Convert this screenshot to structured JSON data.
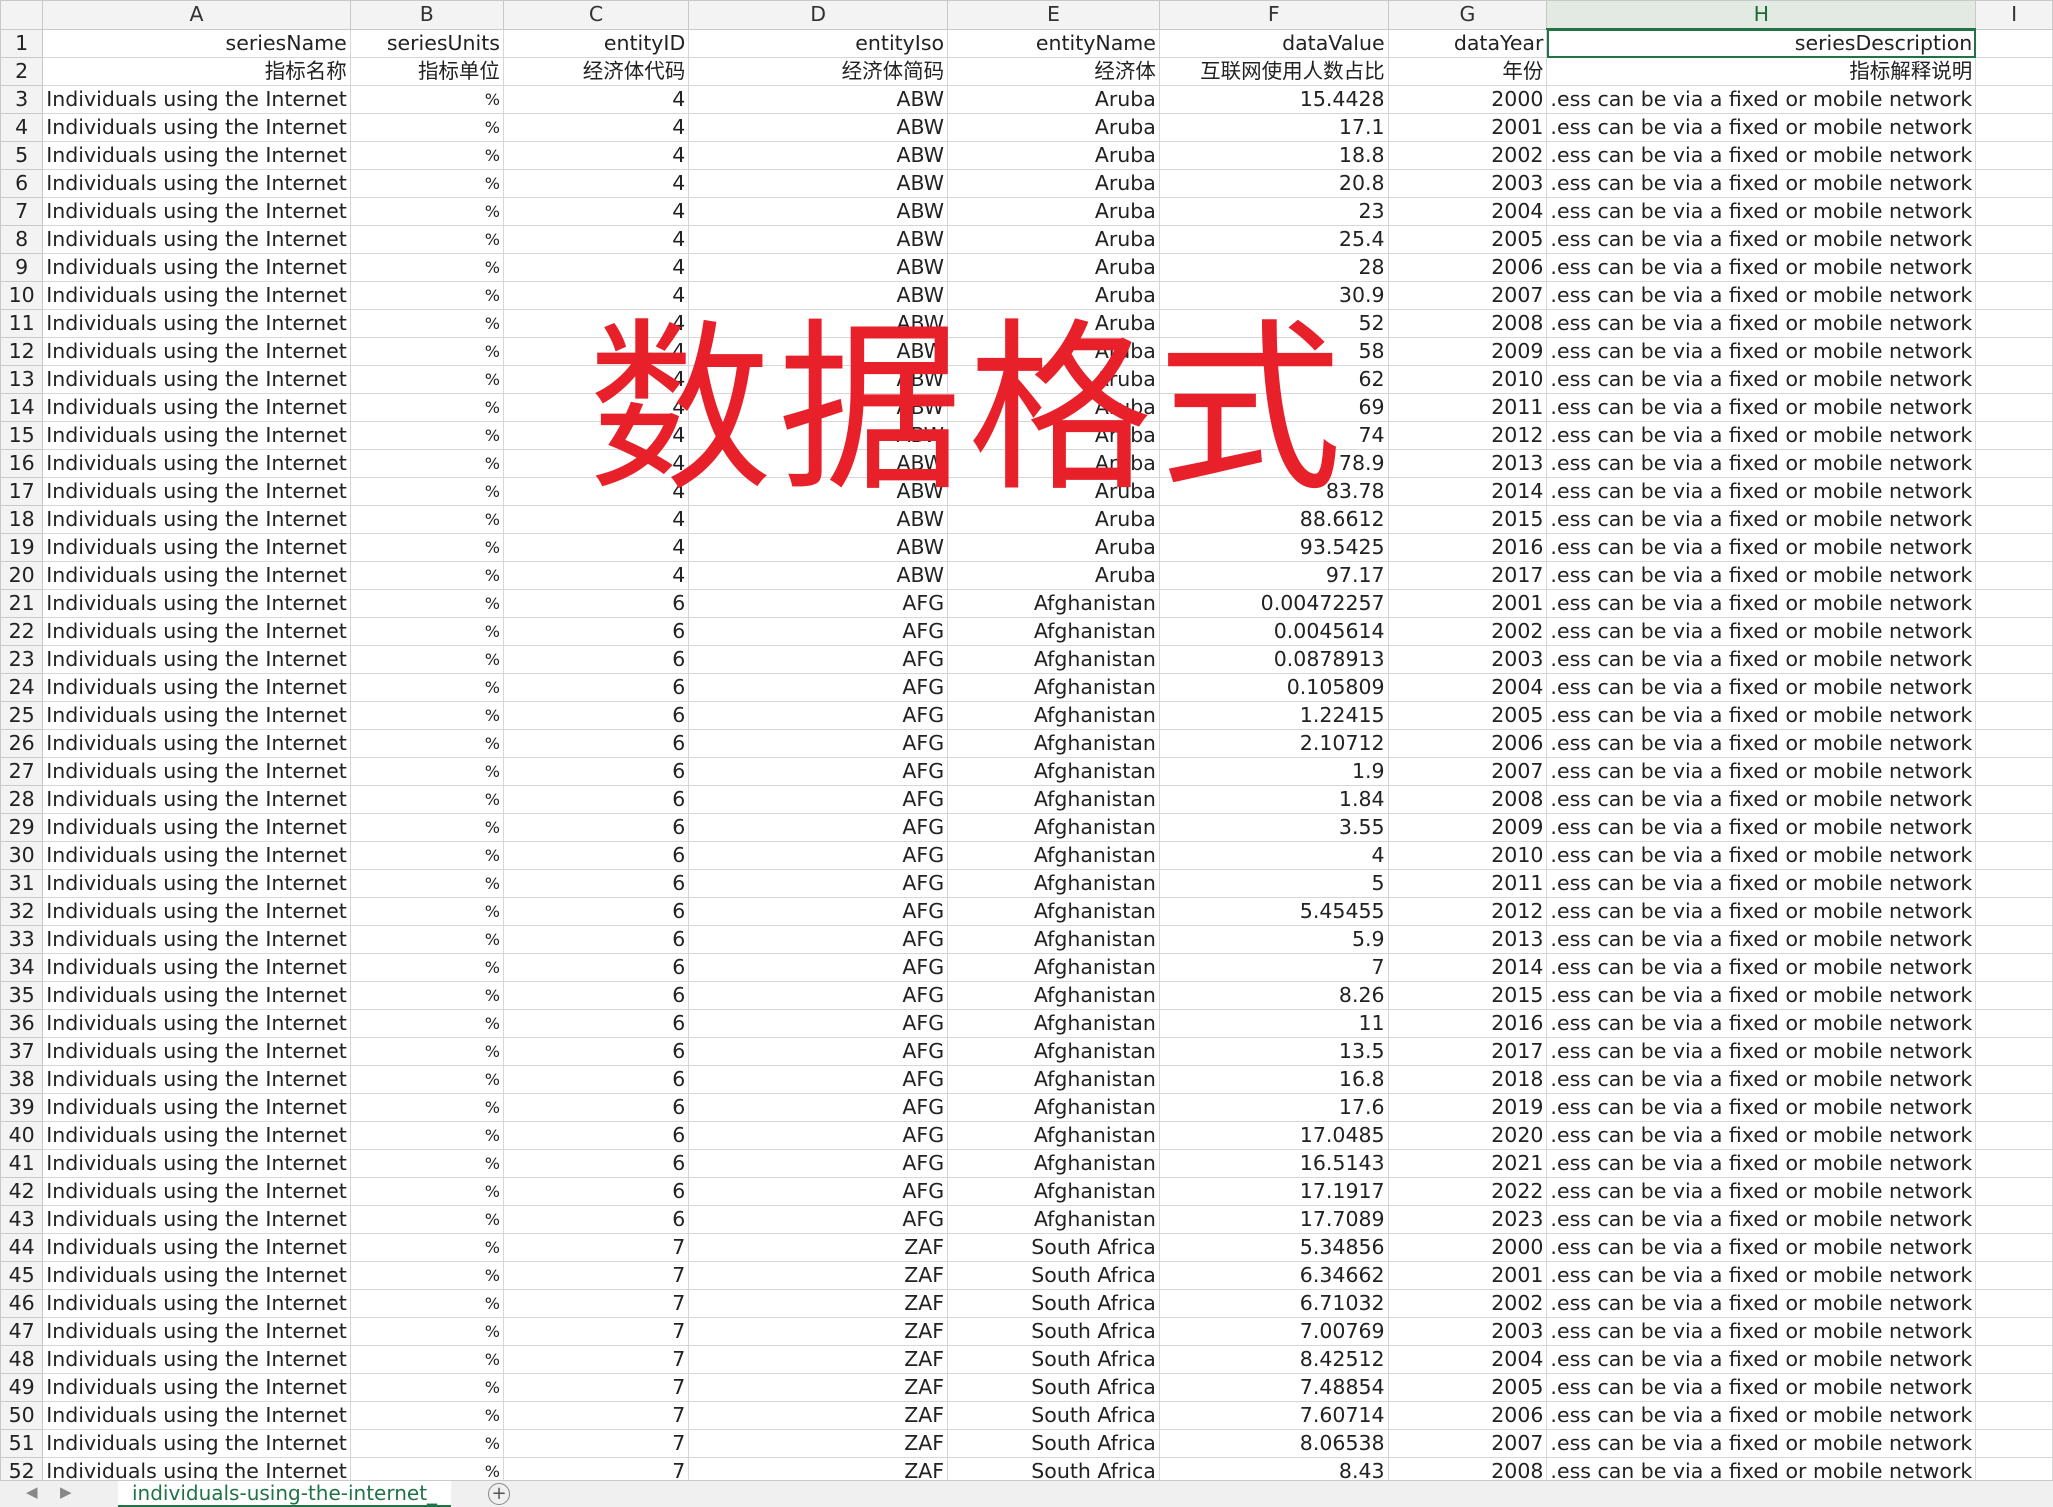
{
  "column_letters": [
    "A",
    "B",
    "C",
    "D",
    "E",
    "F",
    "G",
    "H",
    "I"
  ],
  "row_numbers": [
    1,
    2,
    3,
    4,
    5,
    6,
    7,
    8,
    9,
    10,
    11,
    12,
    13,
    14,
    15,
    16,
    17,
    18,
    19,
    20,
    21,
    22,
    23,
    24,
    25,
    26,
    27,
    28,
    29,
    30,
    31,
    32,
    33,
    34,
    35,
    36,
    37,
    38,
    39,
    40,
    41,
    42,
    43,
    44,
    45,
    46,
    47,
    48,
    49,
    50,
    51,
    52
  ],
  "headers": {
    "seriesName": "seriesName",
    "seriesUnits": "seriesUnits",
    "entityID": "entityID",
    "entityIso": "entityIso",
    "entityName": "entityName",
    "dataValue": "dataValue",
    "dataYear": "dataYear",
    "seriesDescription": "seriesDescription"
  },
  "headers_cn": {
    "seriesName": "指标名称",
    "seriesUnits": "指标单位",
    "entityID": "经济体代码",
    "entityIso": "经济体简码",
    "entityName": "经济体",
    "dataValue": "互联网使用人数占比",
    "dataYear": "年份",
    "seriesDescription": "指标解释说明"
  },
  "common": {
    "series_name": "Individuals using the Internet",
    "unit": "%",
    "description": "ess can be via a fixed or mobile network."
  },
  "rows": [
    {
      "id": "4",
      "iso": "ABW",
      "name": "Aruba",
      "value": "15.4428",
      "year": "2000"
    },
    {
      "id": "4",
      "iso": "ABW",
      "name": "Aruba",
      "value": "17.1",
      "year": "2001"
    },
    {
      "id": "4",
      "iso": "ABW",
      "name": "Aruba",
      "value": "18.8",
      "year": "2002"
    },
    {
      "id": "4",
      "iso": "ABW",
      "name": "Aruba",
      "value": "20.8",
      "year": "2003"
    },
    {
      "id": "4",
      "iso": "ABW",
      "name": "Aruba",
      "value": "23",
      "year": "2004"
    },
    {
      "id": "4",
      "iso": "ABW",
      "name": "Aruba",
      "value": "25.4",
      "year": "2005"
    },
    {
      "id": "4",
      "iso": "ABW",
      "name": "Aruba",
      "value": "28",
      "year": "2006"
    },
    {
      "id": "4",
      "iso": "ABW",
      "name": "Aruba",
      "value": "30.9",
      "year": "2007"
    },
    {
      "id": "4",
      "iso": "ABW",
      "name": "Aruba",
      "value": "52",
      "year": "2008"
    },
    {
      "id": "4",
      "iso": "ABW",
      "name": "Aruba",
      "value": "58",
      "year": "2009"
    },
    {
      "id": "4",
      "iso": "ABW",
      "name": "Aruba",
      "value": "62",
      "year": "2010"
    },
    {
      "id": "4",
      "iso": "ABW",
      "name": "Aruba",
      "value": "69",
      "year": "2011"
    },
    {
      "id": "4",
      "iso": "ABW",
      "name": "Aruba",
      "value": "74",
      "year": "2012"
    },
    {
      "id": "4",
      "iso": "ABW",
      "name": "Aruba",
      "value": "78.9",
      "year": "2013"
    },
    {
      "id": "4",
      "iso": "ABW",
      "name": "Aruba",
      "value": "83.78",
      "year": "2014"
    },
    {
      "id": "4",
      "iso": "ABW",
      "name": "Aruba",
      "value": "88.6612",
      "year": "2015"
    },
    {
      "id": "4",
      "iso": "ABW",
      "name": "Aruba",
      "value": "93.5425",
      "year": "2016"
    },
    {
      "id": "4",
      "iso": "ABW",
      "name": "Aruba",
      "value": "97.17",
      "year": "2017"
    },
    {
      "id": "6",
      "iso": "AFG",
      "name": "Afghanistan",
      "value": "0.00472257",
      "year": "2001"
    },
    {
      "id": "6",
      "iso": "AFG",
      "name": "Afghanistan",
      "value": "0.0045614",
      "year": "2002"
    },
    {
      "id": "6",
      "iso": "AFG",
      "name": "Afghanistan",
      "value": "0.0878913",
      "year": "2003"
    },
    {
      "id": "6",
      "iso": "AFG",
      "name": "Afghanistan",
      "value": "0.105809",
      "year": "2004"
    },
    {
      "id": "6",
      "iso": "AFG",
      "name": "Afghanistan",
      "value": "1.22415",
      "year": "2005"
    },
    {
      "id": "6",
      "iso": "AFG",
      "name": "Afghanistan",
      "value": "2.10712",
      "year": "2006"
    },
    {
      "id": "6",
      "iso": "AFG",
      "name": "Afghanistan",
      "value": "1.9",
      "year": "2007"
    },
    {
      "id": "6",
      "iso": "AFG",
      "name": "Afghanistan",
      "value": "1.84",
      "year": "2008"
    },
    {
      "id": "6",
      "iso": "AFG",
      "name": "Afghanistan",
      "value": "3.55",
      "year": "2009"
    },
    {
      "id": "6",
      "iso": "AFG",
      "name": "Afghanistan",
      "value": "4",
      "year": "2010"
    },
    {
      "id": "6",
      "iso": "AFG",
      "name": "Afghanistan",
      "value": "5",
      "year": "2011"
    },
    {
      "id": "6",
      "iso": "AFG",
      "name": "Afghanistan",
      "value": "5.45455",
      "year": "2012"
    },
    {
      "id": "6",
      "iso": "AFG",
      "name": "Afghanistan",
      "value": "5.9",
      "year": "2013"
    },
    {
      "id": "6",
      "iso": "AFG",
      "name": "Afghanistan",
      "value": "7",
      "year": "2014"
    },
    {
      "id": "6",
      "iso": "AFG",
      "name": "Afghanistan",
      "value": "8.26",
      "year": "2015"
    },
    {
      "id": "6",
      "iso": "AFG",
      "name": "Afghanistan",
      "value": "11",
      "year": "2016"
    },
    {
      "id": "6",
      "iso": "AFG",
      "name": "Afghanistan",
      "value": "13.5",
      "year": "2017"
    },
    {
      "id": "6",
      "iso": "AFG",
      "name": "Afghanistan",
      "value": "16.8",
      "year": "2018"
    },
    {
      "id": "6",
      "iso": "AFG",
      "name": "Afghanistan",
      "value": "17.6",
      "year": "2019"
    },
    {
      "id": "6",
      "iso": "AFG",
      "name": "Afghanistan",
      "value": "17.0485",
      "year": "2020"
    },
    {
      "id": "6",
      "iso": "AFG",
      "name": "Afghanistan",
      "value": "16.5143",
      "year": "2021"
    },
    {
      "id": "6",
      "iso": "AFG",
      "name": "Afghanistan",
      "value": "17.1917",
      "year": "2022"
    },
    {
      "id": "6",
      "iso": "AFG",
      "name": "Afghanistan",
      "value": "17.7089",
      "year": "2023"
    },
    {
      "id": "7",
      "iso": "ZAF",
      "name": "South Africa",
      "value": "5.34856",
      "year": "2000"
    },
    {
      "id": "7",
      "iso": "ZAF",
      "name": "South Africa",
      "value": "6.34662",
      "year": "2001"
    },
    {
      "id": "7",
      "iso": "ZAF",
      "name": "South Africa",
      "value": "6.71032",
      "year": "2002"
    },
    {
      "id": "7",
      "iso": "ZAF",
      "name": "South Africa",
      "value": "7.00769",
      "year": "2003"
    },
    {
      "id": "7",
      "iso": "ZAF",
      "name": "South Africa",
      "value": "8.42512",
      "year": "2004"
    },
    {
      "id": "7",
      "iso": "ZAF",
      "name": "South Africa",
      "value": "7.48854",
      "year": "2005"
    },
    {
      "id": "7",
      "iso": "ZAF",
      "name": "South Africa",
      "value": "7.60714",
      "year": "2006"
    },
    {
      "id": "7",
      "iso": "ZAF",
      "name": "South Africa",
      "value": "8.06538",
      "year": "2007"
    },
    {
      "id": "7",
      "iso": "ZAF",
      "name": "South Africa",
      "value": "8.43",
      "year": "2008"
    }
  ],
  "watermark": "数据格式",
  "sheet_tab": "individuals-using-the-internet_",
  "icons": {
    "prev": "chevron-left-icon",
    "next": "chevron-right-icon",
    "add": "plus-icon"
  },
  "colors": {
    "accent": "#217346",
    "watermark": "#e8202a"
  }
}
